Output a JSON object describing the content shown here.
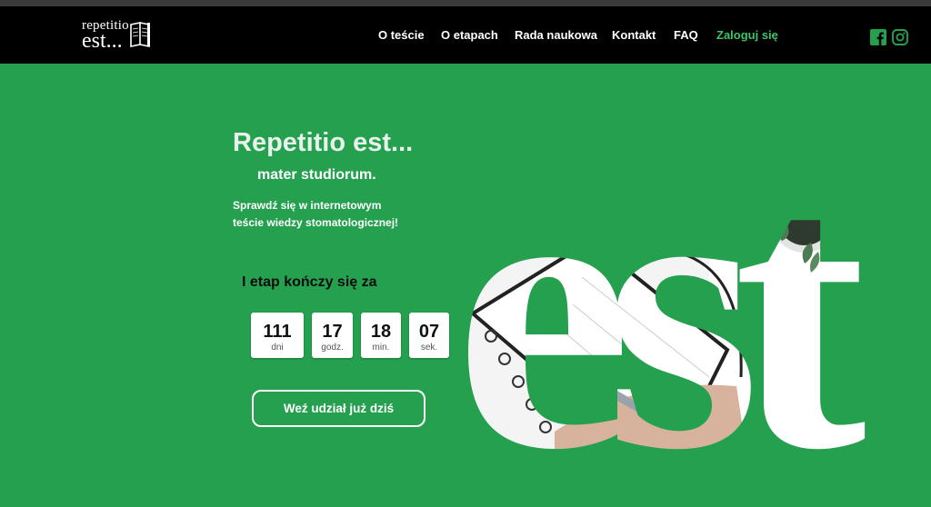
{
  "logo": {
    "line1": "repetitio",
    "line2": "est..."
  },
  "nav": {
    "items": [
      {
        "label": "O teście"
      },
      {
        "label": "O etapach"
      },
      {
        "label": "Rada naukowa"
      },
      {
        "label": "Kontakt"
      },
      {
        "label": "FAQ"
      }
    ],
    "login": "Zaloguj się",
    "social": [
      "facebook-icon",
      "instagram-icon"
    ]
  },
  "hero": {
    "title": "Repetitio est...",
    "subtitle": "mater studiorum.",
    "desc_line1": "Sprawdź się w internetowym",
    "desc_line2": "teście wiedzy stomatologicznej!"
  },
  "countdown": {
    "label": "I etap kończy się za",
    "units": [
      {
        "value": "111",
        "unit": "dni"
      },
      {
        "value": "17",
        "unit": "godz."
      },
      {
        "value": "18",
        "unit": "min."
      },
      {
        "value": "07",
        "unit": "sek."
      }
    ]
  },
  "cta": {
    "label": "Weź udział już dziś"
  },
  "colors": {
    "background": "#25a04f",
    "navbar": "#000000",
    "accent": "#3fc46a"
  }
}
